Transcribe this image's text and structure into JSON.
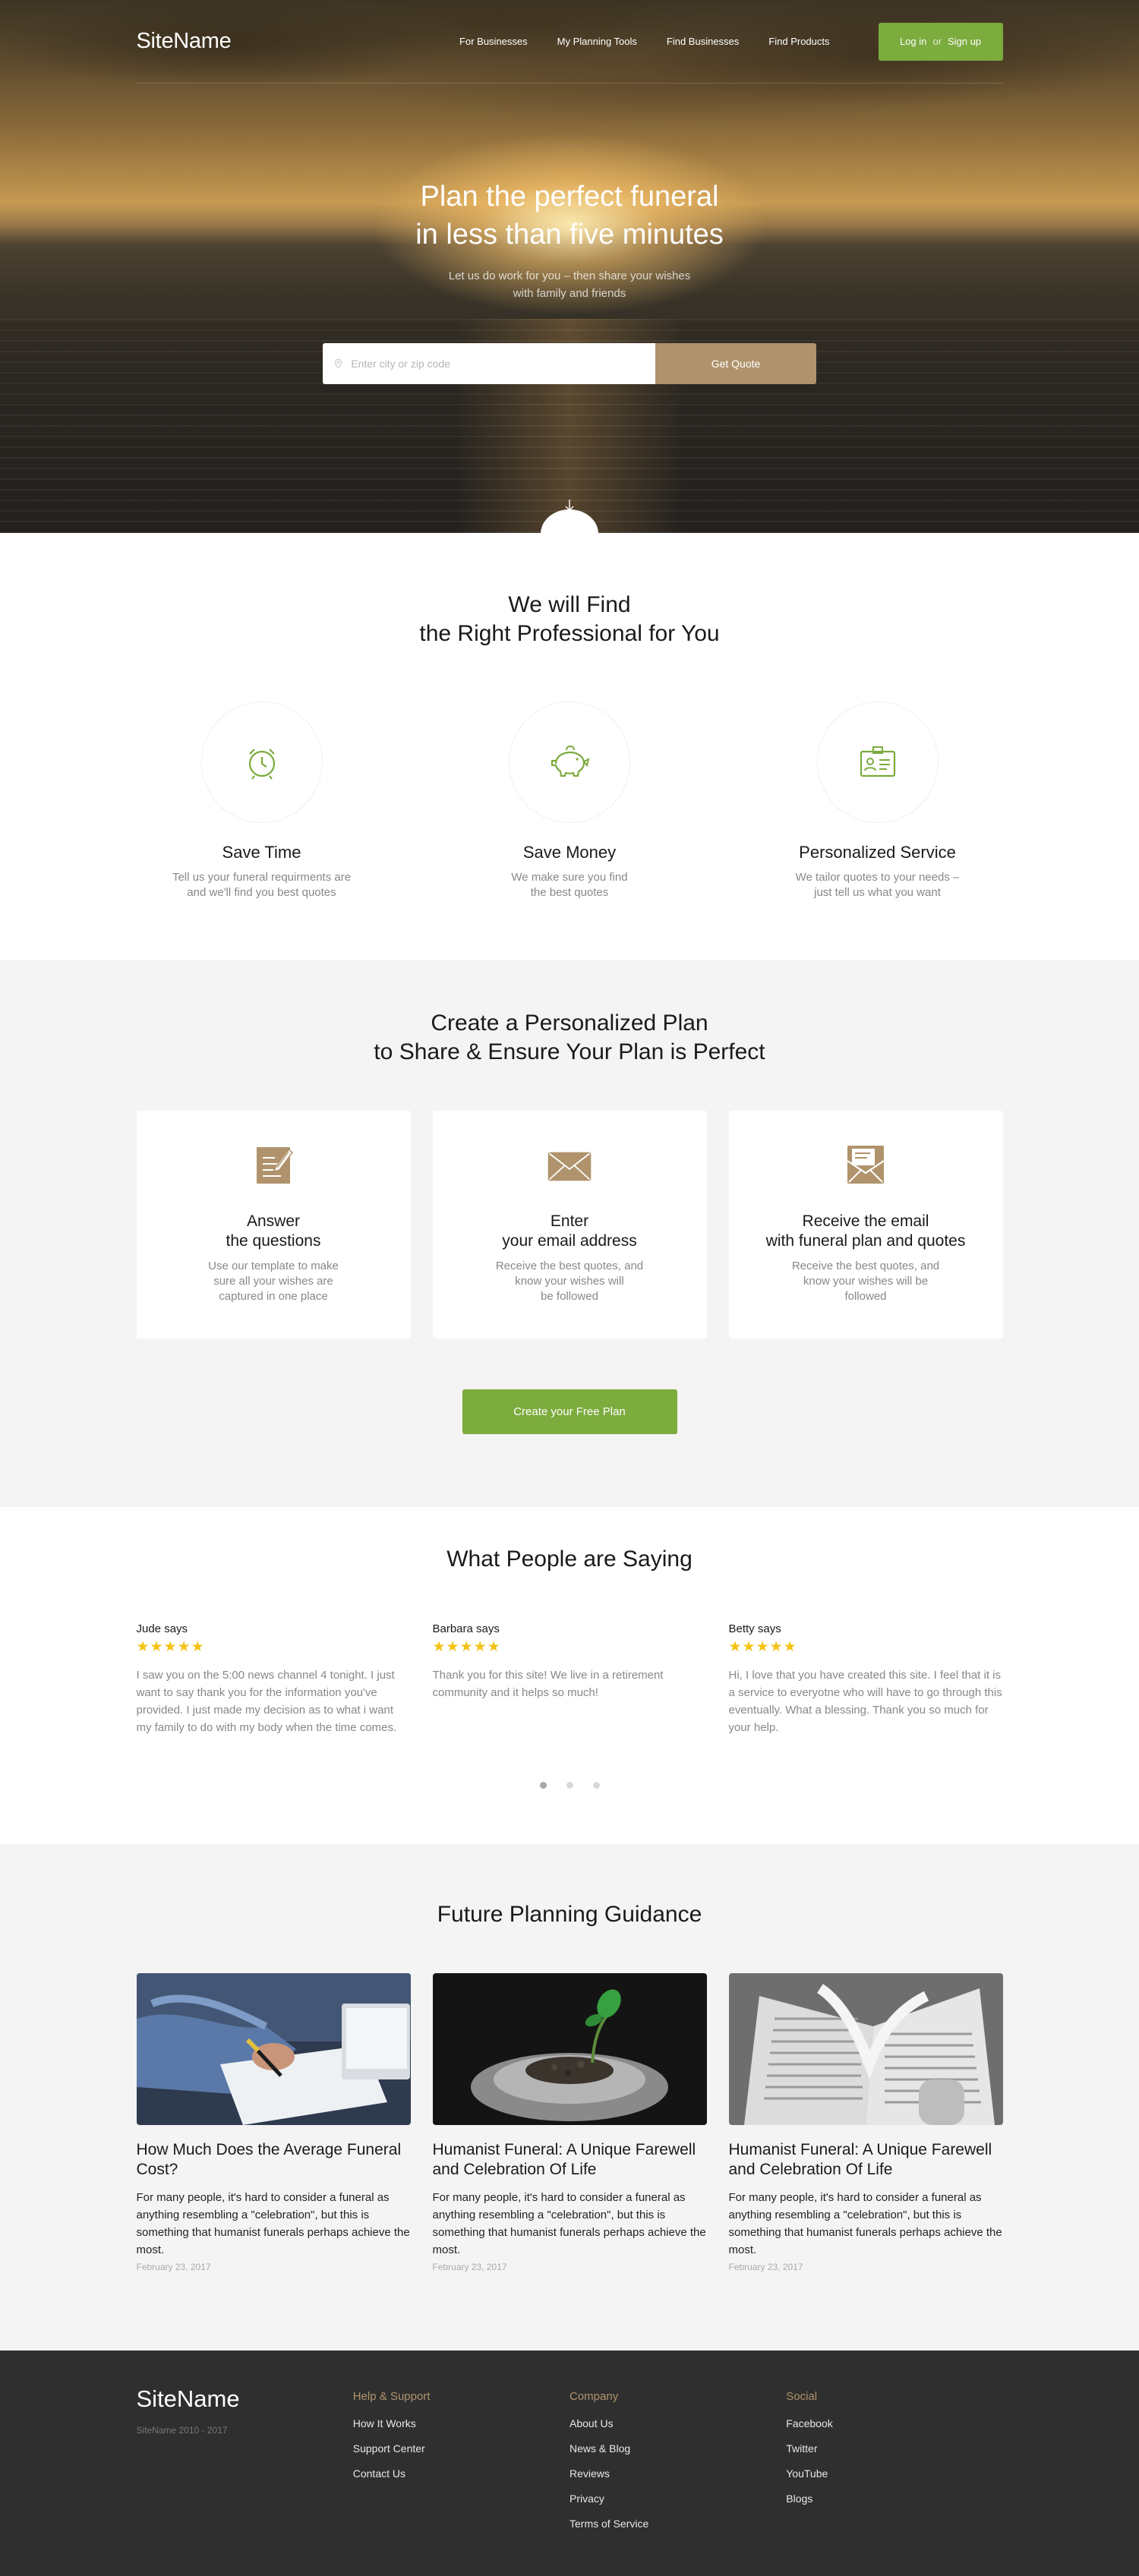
{
  "nav": {
    "logo": "SiteName",
    "links": [
      "For Businesses",
      "My Planning Tools",
      "Find Businesses",
      "Find Products"
    ],
    "login": "Log in",
    "or": "or",
    "signup": "Sign up"
  },
  "hero": {
    "title_line1": "Plan the perfect funeral",
    "title_line2": "in less than five minutes",
    "sub_line1": "Let us do work for you – then share your wishes",
    "sub_line2": "with family and friends",
    "search_placeholder": "Enter city or zip code",
    "search_value": "",
    "quote_button": "Get Quote"
  },
  "find": {
    "title_line1": "We will Find",
    "title_line2": "the Right Professional for You",
    "features": [
      {
        "title": "Save Time",
        "line1": "Tell us your funeral requirments are",
        "line2": "and we'll find you best quotes",
        "icon": "alarm-clock-icon"
      },
      {
        "title": "Save Money",
        "line1": "We make sure you find",
        "line2": "the best quotes",
        "icon": "piggy-bank-icon"
      },
      {
        "title": "Personalized Service",
        "line1": "We tailor quotes to your needs –",
        "line2": "just tell us what you want",
        "icon": "id-card-icon"
      }
    ]
  },
  "plan": {
    "title_line1": "Create a Personalized Plan",
    "title_line2": "to Share & Ensure Your Plan is Perfect",
    "cards": [
      {
        "title1": "Answer",
        "title2": "the questions",
        "text1": "Use our template to make",
        "text2": "sure all your wishes are",
        "text3": "captured in one place",
        "icon": "edit-document-icon"
      },
      {
        "title1": "Enter",
        "title2": "your email address",
        "text1": "Receive the best quotes, and",
        "text2": "know your wishes will",
        "text3": "be followed",
        "icon": "envelope-icon"
      },
      {
        "title1": "Receive the email",
        "title2": "with funeral plan and quotes",
        "text1": "Receive the best quotes, and",
        "text2": "know your wishes will be",
        "text3": "followed",
        "icon": "open-envelope-icon"
      }
    ],
    "cta": "Create your Free Plan"
  },
  "reviews": {
    "title": "What People are Saying",
    "stars": "★★★★★",
    "items": [
      {
        "name": "Jude says",
        "text": "I saw you on the 5:00 news channel 4 tonight. I just want to say thank you for the information you've provided. I just made my decision as to what i want my family to do with my body when the time comes."
      },
      {
        "name": "Barbara says",
        "text": "Thank you for this site! We live in a retirement community and it helps so much!"
      },
      {
        "name": "Betty says",
        "text": "Hi, I love that you have created this site. I feel that it is a service to everyotne who will have to go through this eventually. What a blessing. Thank you so much for your help."
      }
    ],
    "active_dot": 0
  },
  "guidance": {
    "title": "Future Planning Guidance",
    "posts": [
      {
        "title": "How Much Does the Average Funeral Cost?",
        "text": "For many people, it's hard to consider a funeral as anything resembling a \"celebration\", but this is something that humanist funerals perhaps achieve the most.",
        "date": "February 23, 2017"
      },
      {
        "title": "Humanist Funeral: A Unique Farewell and Celebration Of Life",
        "text": "For many people, it's hard to consider a funeral as anything resembling a \"celebration\", but this is something that humanist funerals perhaps achieve the most.",
        "date": "February 23, 2017"
      },
      {
        "title": "Humanist Funeral: A Unique Farewell and Celebration Of Life",
        "text": "For many people, it's hard to consider a funeral as anything resembling a \"celebration\", but this is something that humanist funerals perhaps achieve the most.",
        "date": "February 23, 2017"
      }
    ]
  },
  "footer": {
    "logo": "SiteName",
    "copyright": "SiteName 2010 - 2017",
    "columns": [
      {
        "heading": "Help & Support",
        "links": [
          "How It Works",
          "Support Center",
          "Contact Us"
        ]
      },
      {
        "heading": "Company",
        "links": [
          "About Us",
          "News & Blog",
          "Reviews",
          "Privacy",
          "Terms of Service"
        ]
      },
      {
        "heading": "Social",
        "links": [
          "Facebook",
          "Twitter",
          "YouTube",
          "Blogs"
        ]
      }
    ]
  },
  "colors": {
    "accent_green": "#7cab3e",
    "accent_tan": "#b0936c",
    "star_yellow": "#f4c212",
    "footer_bg": "#2f2f2f",
    "section_gray": "#f4f4f4"
  }
}
